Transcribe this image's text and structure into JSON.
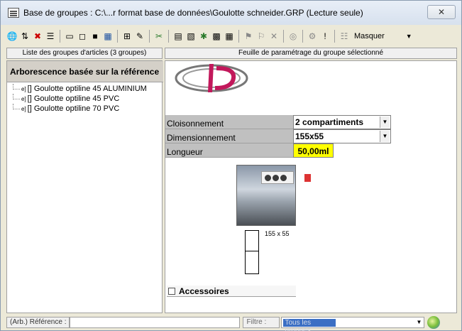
{
  "window": {
    "title": "Base de groupes : C:\\...r format base de données\\Goulotte schneider.GRP (Lecture seule)",
    "close_label": "✕"
  },
  "toolbar": {
    "icons": [
      "globe-icon",
      "move-icon",
      "delete-icon",
      "list-icon",
      "minus-icon",
      "box-icon",
      "square-icon",
      "chart-icon",
      "tree-icon",
      "edit-icon",
      "tool-icon",
      "paste-icon",
      "picture-icon",
      "grid-icon",
      "tag-icon",
      "tag2-icon",
      "cross-icon",
      "circle-icon",
      "flag-icon",
      "exclaim-icon",
      "filter-icon"
    ],
    "masquer_label": "Masquer"
  },
  "left": {
    "header": "Liste des groupes d'articles (3 groupes)",
    "tree_title": "Arborescence basée sur la référence",
    "items": [
      {
        "label": "[] Goulotte optiline 45 ALUMINIUM"
      },
      {
        "label": "[] Goulotte optiline 45 PVC"
      },
      {
        "label": "[] Goulotte optiline 70 PVC"
      }
    ]
  },
  "right": {
    "header": "Feuille de paramétrage du groupe sélectionné",
    "params": [
      {
        "label": "Cloisonnement",
        "value": "2 compartiments"
      },
      {
        "label": "Dimensionnement",
        "value": "155x55"
      },
      {
        "label": "Longueur",
        "value": "50,00ml"
      }
    ],
    "dimension_label": "155 x 55",
    "accessories_label": "Accessoires"
  },
  "status": {
    "reference_label": "(Arb.) Référence :",
    "filter_label": "Filtre :",
    "filter_value": "Tous les groupes"
  },
  "colors": {
    "highlight_yellow": "#ffff00",
    "select_blue": "#3b6fc4"
  }
}
